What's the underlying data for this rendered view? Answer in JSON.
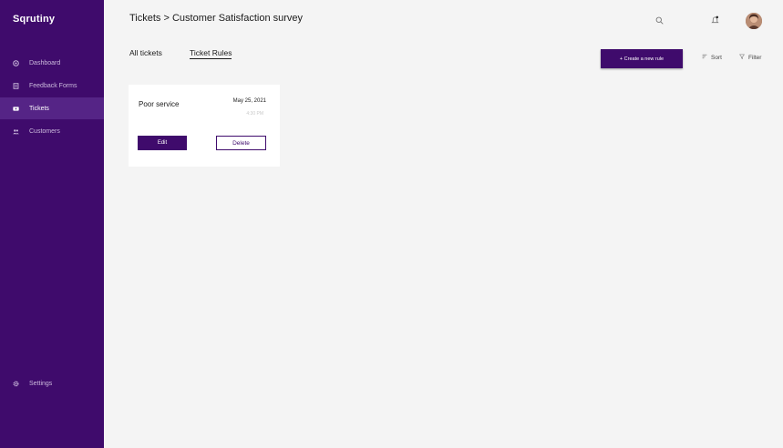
{
  "app": {
    "brand": "Sqrutiny"
  },
  "sidebar": {
    "items": [
      {
        "label": "Dashboard",
        "icon": "dashboard-icon",
        "active": false
      },
      {
        "label": "Feedback Forms",
        "icon": "form-icon",
        "active": false
      },
      {
        "label": "Tickets",
        "icon": "ticket-icon",
        "active": true
      },
      {
        "label": "Customers",
        "icon": "users-icon",
        "active": false
      }
    ],
    "settings": {
      "label": "Settings",
      "icon": "gear-icon"
    }
  },
  "header": {
    "breadcrumb": "Tickets > Customer Satisfaction survey",
    "icons": [
      "search-icon",
      "bell-icon",
      "avatar"
    ]
  },
  "tabs": [
    {
      "label": "All tickets",
      "active": false
    },
    {
      "label": "Ticket Rules",
      "active": true
    }
  ],
  "toolbar": {
    "create_label": "+ Create a new rule",
    "sort_label": "Sort",
    "filter_label": "Filter"
  },
  "rules": [
    {
      "title": "Poor service",
      "date": "May 25, 2021",
      "time": "4:30 PM",
      "edit_label": "Edit",
      "delete_label": "Delete"
    }
  ],
  "colors": {
    "brand": "#3f0b6c",
    "sidebar_active": "#552486",
    "background": "#f4f4f4",
    "card": "#ffffff"
  }
}
